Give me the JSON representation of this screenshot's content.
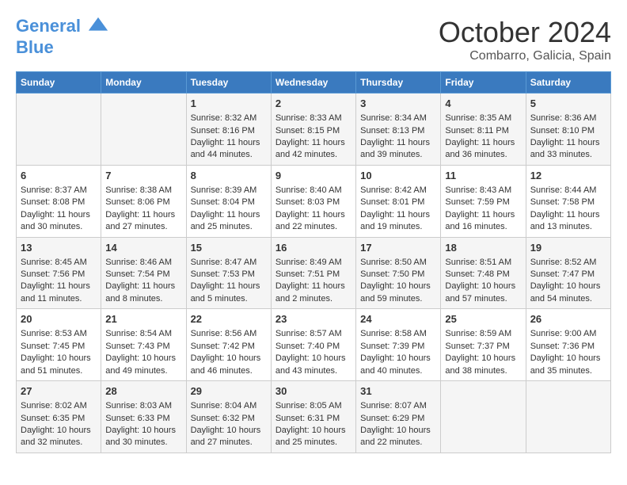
{
  "header": {
    "logo_line1": "General",
    "logo_line2": "Blue",
    "month": "October 2024",
    "location": "Combarro, Galicia, Spain"
  },
  "weekdays": [
    "Sunday",
    "Monday",
    "Tuesday",
    "Wednesday",
    "Thursday",
    "Friday",
    "Saturday"
  ],
  "weeks": [
    [
      {
        "day": "",
        "lines": []
      },
      {
        "day": "",
        "lines": []
      },
      {
        "day": "1",
        "lines": [
          "Sunrise: 8:32 AM",
          "Sunset: 8:16 PM",
          "Daylight: 11 hours and 44 minutes."
        ]
      },
      {
        "day": "2",
        "lines": [
          "Sunrise: 8:33 AM",
          "Sunset: 8:15 PM",
          "Daylight: 11 hours and 42 minutes."
        ]
      },
      {
        "day": "3",
        "lines": [
          "Sunrise: 8:34 AM",
          "Sunset: 8:13 PM",
          "Daylight: 11 hours and 39 minutes."
        ]
      },
      {
        "day": "4",
        "lines": [
          "Sunrise: 8:35 AM",
          "Sunset: 8:11 PM",
          "Daylight: 11 hours and 36 minutes."
        ]
      },
      {
        "day": "5",
        "lines": [
          "Sunrise: 8:36 AM",
          "Sunset: 8:10 PM",
          "Daylight: 11 hours and 33 minutes."
        ]
      }
    ],
    [
      {
        "day": "6",
        "lines": [
          "Sunrise: 8:37 AM",
          "Sunset: 8:08 PM",
          "Daylight: 11 hours and 30 minutes."
        ]
      },
      {
        "day": "7",
        "lines": [
          "Sunrise: 8:38 AM",
          "Sunset: 8:06 PM",
          "Daylight: 11 hours and 27 minutes."
        ]
      },
      {
        "day": "8",
        "lines": [
          "Sunrise: 8:39 AM",
          "Sunset: 8:04 PM",
          "Daylight: 11 hours and 25 minutes."
        ]
      },
      {
        "day": "9",
        "lines": [
          "Sunrise: 8:40 AM",
          "Sunset: 8:03 PM",
          "Daylight: 11 hours and 22 minutes."
        ]
      },
      {
        "day": "10",
        "lines": [
          "Sunrise: 8:42 AM",
          "Sunset: 8:01 PM",
          "Daylight: 11 hours and 19 minutes."
        ]
      },
      {
        "day": "11",
        "lines": [
          "Sunrise: 8:43 AM",
          "Sunset: 7:59 PM",
          "Daylight: 11 hours and 16 minutes."
        ]
      },
      {
        "day": "12",
        "lines": [
          "Sunrise: 8:44 AM",
          "Sunset: 7:58 PM",
          "Daylight: 11 hours and 13 minutes."
        ]
      }
    ],
    [
      {
        "day": "13",
        "lines": [
          "Sunrise: 8:45 AM",
          "Sunset: 7:56 PM",
          "Daylight: 11 hours and 11 minutes."
        ]
      },
      {
        "day": "14",
        "lines": [
          "Sunrise: 8:46 AM",
          "Sunset: 7:54 PM",
          "Daylight: 11 hours and 8 minutes."
        ]
      },
      {
        "day": "15",
        "lines": [
          "Sunrise: 8:47 AM",
          "Sunset: 7:53 PM",
          "Daylight: 11 hours and 5 minutes."
        ]
      },
      {
        "day": "16",
        "lines": [
          "Sunrise: 8:49 AM",
          "Sunset: 7:51 PM",
          "Daylight: 11 hours and 2 minutes."
        ]
      },
      {
        "day": "17",
        "lines": [
          "Sunrise: 8:50 AM",
          "Sunset: 7:50 PM",
          "Daylight: 10 hours and 59 minutes."
        ]
      },
      {
        "day": "18",
        "lines": [
          "Sunrise: 8:51 AM",
          "Sunset: 7:48 PM",
          "Daylight: 10 hours and 57 minutes."
        ]
      },
      {
        "day": "19",
        "lines": [
          "Sunrise: 8:52 AM",
          "Sunset: 7:47 PM",
          "Daylight: 10 hours and 54 minutes."
        ]
      }
    ],
    [
      {
        "day": "20",
        "lines": [
          "Sunrise: 8:53 AM",
          "Sunset: 7:45 PM",
          "Daylight: 10 hours and 51 minutes."
        ]
      },
      {
        "day": "21",
        "lines": [
          "Sunrise: 8:54 AM",
          "Sunset: 7:43 PM",
          "Daylight: 10 hours and 49 minutes."
        ]
      },
      {
        "day": "22",
        "lines": [
          "Sunrise: 8:56 AM",
          "Sunset: 7:42 PM",
          "Daylight: 10 hours and 46 minutes."
        ]
      },
      {
        "day": "23",
        "lines": [
          "Sunrise: 8:57 AM",
          "Sunset: 7:40 PM",
          "Daylight: 10 hours and 43 minutes."
        ]
      },
      {
        "day": "24",
        "lines": [
          "Sunrise: 8:58 AM",
          "Sunset: 7:39 PM",
          "Daylight: 10 hours and 40 minutes."
        ]
      },
      {
        "day": "25",
        "lines": [
          "Sunrise: 8:59 AM",
          "Sunset: 7:37 PM",
          "Daylight: 10 hours and 38 minutes."
        ]
      },
      {
        "day": "26",
        "lines": [
          "Sunrise: 9:00 AM",
          "Sunset: 7:36 PM",
          "Daylight: 10 hours and 35 minutes."
        ]
      }
    ],
    [
      {
        "day": "27",
        "lines": [
          "Sunrise: 8:02 AM",
          "Sunset: 6:35 PM",
          "Daylight: 10 hours and 32 minutes."
        ]
      },
      {
        "day": "28",
        "lines": [
          "Sunrise: 8:03 AM",
          "Sunset: 6:33 PM",
          "Daylight: 10 hours and 30 minutes."
        ]
      },
      {
        "day": "29",
        "lines": [
          "Sunrise: 8:04 AM",
          "Sunset: 6:32 PM",
          "Daylight: 10 hours and 27 minutes."
        ]
      },
      {
        "day": "30",
        "lines": [
          "Sunrise: 8:05 AM",
          "Sunset: 6:31 PM",
          "Daylight: 10 hours and 25 minutes."
        ]
      },
      {
        "day": "31",
        "lines": [
          "Sunrise: 8:07 AM",
          "Sunset: 6:29 PM",
          "Daylight: 10 hours and 22 minutes."
        ]
      },
      {
        "day": "",
        "lines": []
      },
      {
        "day": "",
        "lines": []
      }
    ]
  ]
}
